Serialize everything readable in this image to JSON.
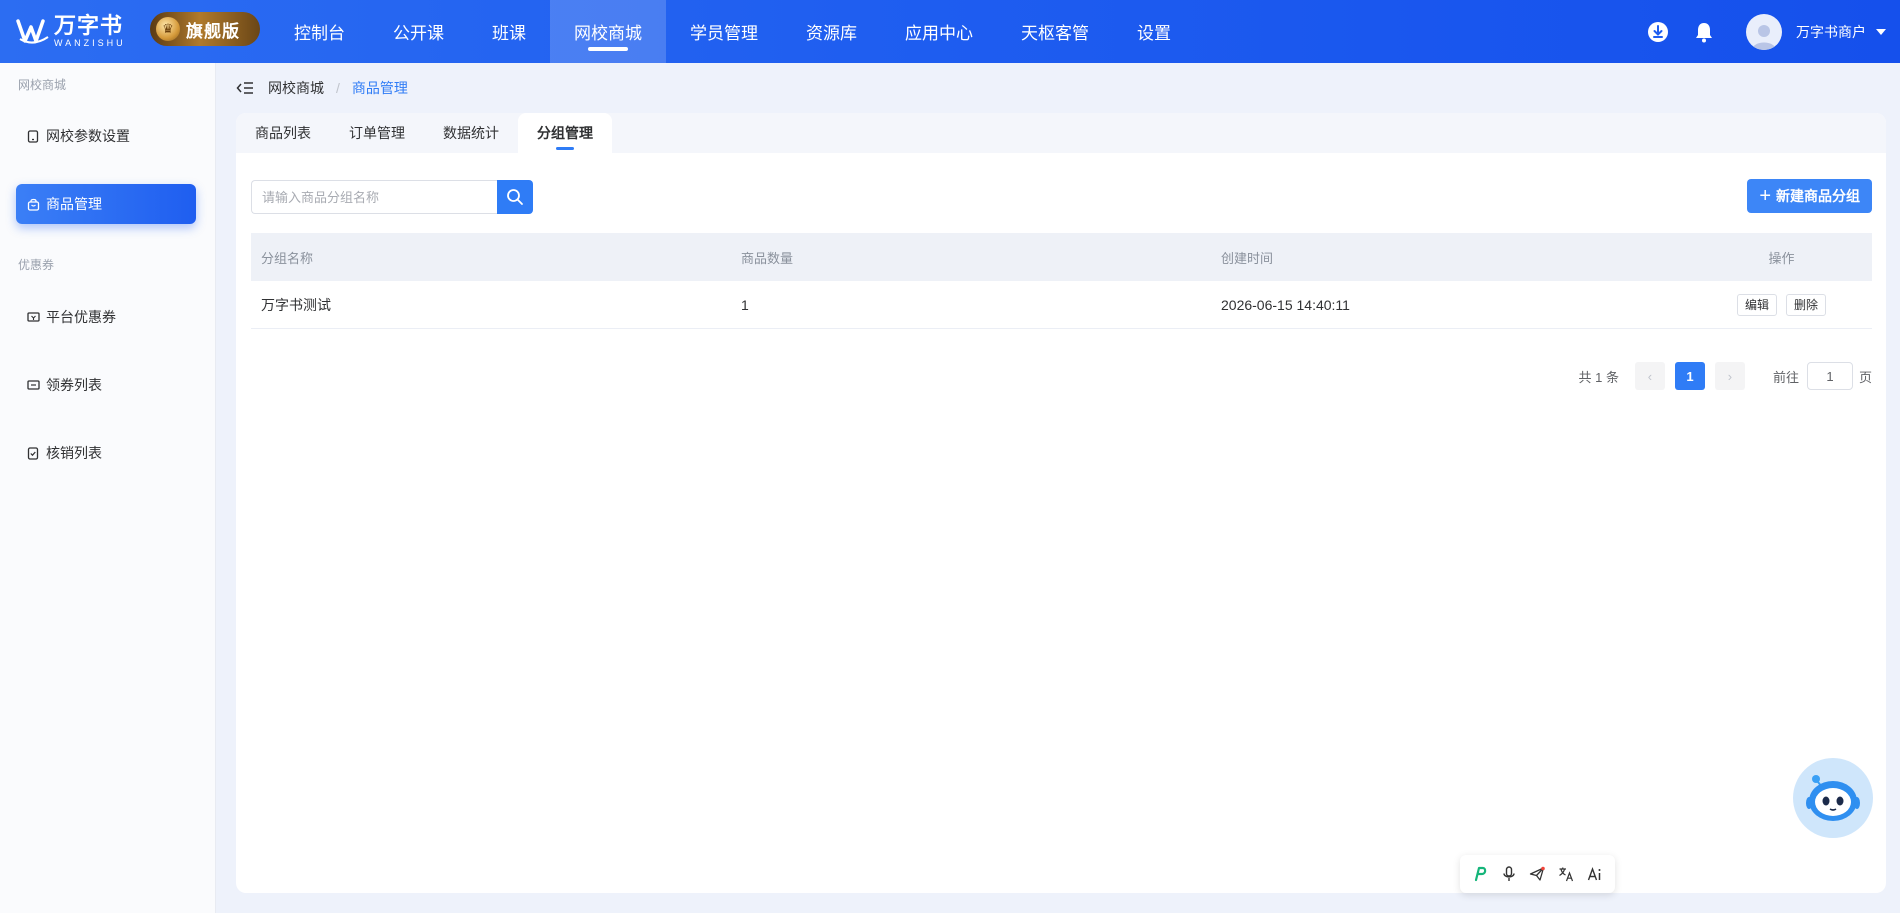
{
  "brand": {
    "name_cn": "万字书",
    "name_en": "WANZISHU",
    "edition": "旗舰版"
  },
  "nav": {
    "items": [
      {
        "label": "控制台",
        "active": false
      },
      {
        "label": "公开课",
        "active": false
      },
      {
        "label": "班课",
        "active": false
      },
      {
        "label": "网校商城",
        "active": true
      },
      {
        "label": "学员管理",
        "active": false
      },
      {
        "label": "资源库",
        "active": false
      },
      {
        "label": "应用中心",
        "active": false
      },
      {
        "label": "天枢客管",
        "active": false
      },
      {
        "label": "设置",
        "active": false
      }
    ]
  },
  "user": {
    "name": "万字书商户"
  },
  "sidebar": {
    "group1": "网校商城",
    "group2": "优惠券",
    "items": [
      {
        "label": "网校参数设置",
        "icon": "tablet-icon",
        "active": false
      },
      {
        "label": "商品管理",
        "icon": "bag-icon",
        "active": true
      },
      {
        "label": "平台优惠券",
        "icon": "ticket-icon",
        "active": false
      },
      {
        "label": "领券列表",
        "icon": "coupon-icon",
        "active": false
      },
      {
        "label": "核销列表",
        "icon": "check-icon",
        "active": false
      }
    ]
  },
  "breadcrumb": {
    "parent": "网校商城",
    "separator": "/",
    "current": "商品管理"
  },
  "tabs": [
    {
      "label": "商品列表",
      "active": false
    },
    {
      "label": "订单管理",
      "active": false
    },
    {
      "label": "数据统计",
      "active": false
    },
    {
      "label": "分组管理",
      "active": true
    }
  ],
  "search": {
    "placeholder": "请输入商品分组名称",
    "value": ""
  },
  "actions": {
    "new_group": "新建商品分组"
  },
  "table": {
    "columns": [
      "分组名称",
      "商品数量",
      "创建时间",
      "操作"
    ],
    "rows": [
      {
        "name": "万字书测试",
        "count": "1",
        "created": "2026-06-15 14:40:11",
        "edit": "编辑",
        "delete": "删除"
      }
    ]
  },
  "pagination": {
    "total": "共 1 条",
    "current": "1",
    "goto_prefix": "前往",
    "goto_value": "1",
    "goto_suffix": "页"
  },
  "colors": {
    "primary": "#2f7cf6",
    "topbar": "#1f5ef0"
  }
}
